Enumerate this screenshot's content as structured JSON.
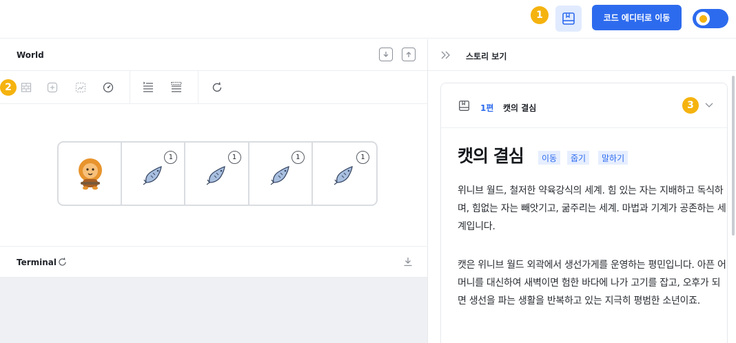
{
  "topbar": {
    "badge1": "1",
    "editor_button_label": "코드 에디터로 이동"
  },
  "world": {
    "title": "World",
    "badge2": "2",
    "grid": [
      {
        "type": "lion"
      },
      {
        "type": "fish",
        "count": "1"
      },
      {
        "type": "fish",
        "count": "1"
      },
      {
        "type": "fish",
        "count": "1"
      },
      {
        "type": "fish",
        "count": "1"
      }
    ]
  },
  "terminal": {
    "title": "Terminal"
  },
  "story": {
    "header_title": "스토리 보기",
    "episode": "1편",
    "episode_title": "캣의 결심",
    "badge3": "3",
    "heading": "캣의 결심",
    "tags": [
      "이동",
      "줍기",
      "말하기"
    ],
    "paragraphs": [
      "위니브 월드, 철저한 약육강식의 세계. 힘 있는 자는 지배하고 독식하며, 힘없는 자는 빼앗기고, 굶주리는 세계. 마법과 기계가 공존하는 세계입니다.",
      "캣은 위니브 월드 외곽에서 생선가게를 운영하는 평민입니다. 아픈 어머니를 대신하여 새벽이면 험한 바다에 나가 고기를 잡고, 오후가 되면 생선을 파는 생활을 반복하고 있는 지극히 평범한 소년이죠."
    ]
  },
  "colors": {
    "accent": "#2d6bee",
    "badge": "#f5b30f",
    "terminal_bg": "#eef0f3"
  }
}
